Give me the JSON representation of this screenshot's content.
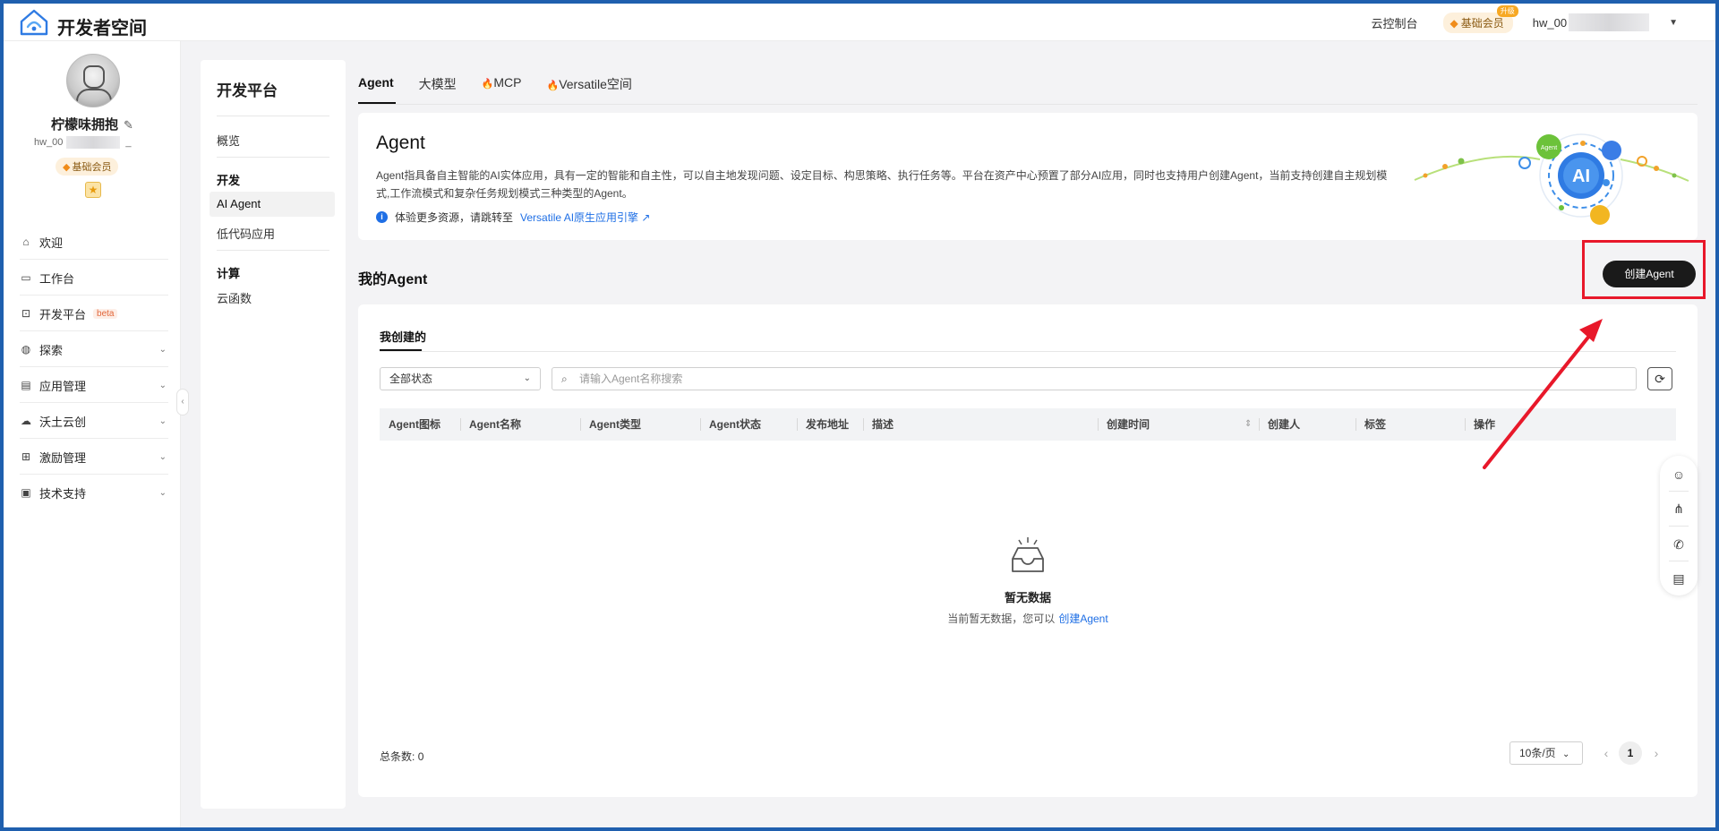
{
  "header": {
    "brand": "开发者空间",
    "console_link": "云控制台",
    "member_label": "基础会员",
    "member_tag": "升级",
    "user_name": "hw_00"
  },
  "profile": {
    "name": "柠檬味拥抱",
    "user_id": "hw_00",
    "user_id_tail": "_",
    "member_label": "基础会员"
  },
  "sidebar": {
    "items": [
      {
        "label": "欢迎",
        "icon": "home-icon"
      },
      {
        "label": "工作台",
        "icon": "workbench-icon"
      },
      {
        "label": "开发平台",
        "icon": "dev-platform-icon",
        "badge": "beta"
      },
      {
        "label": "探索",
        "icon": "explore-icon"
      },
      {
        "label": "应用管理",
        "icon": "app-manage-icon"
      },
      {
        "label": "沃土云创",
        "icon": "cloud-create-icon"
      },
      {
        "label": "激励管理",
        "icon": "gift-icon"
      },
      {
        "label": "技术支持",
        "icon": "support-icon"
      }
    ]
  },
  "subnav": {
    "title": "开发平台",
    "overview": "概览",
    "group_dev": "开发",
    "ai_agent": "AI Agent",
    "lowcode": "低代码应用",
    "group_compute": "计算",
    "cloud_func": "云函数"
  },
  "tabs": [
    {
      "label": "Agent"
    },
    {
      "label": "大模型"
    },
    {
      "label": "MCP"
    },
    {
      "label": "Versatile空间"
    }
  ],
  "intro": {
    "title": "Agent",
    "description": "Agent指具备自主智能的AI实体应用，具有一定的智能和自主性，可以自主地发现问题、设定目标、构思策略、执行任务等。平台在资产中心预置了部分AI应用，同时也支持用户创建Agent，当前支持创建自主规划模式,工作流模式和复杂任务规划模式三种类型的Agent。",
    "note": "体验更多资源，请跳转至",
    "note_link": "Versatile AI原生应用引擎",
    "graphic_label": "AI",
    "graphic_bubble": "Agent"
  },
  "my_agent": {
    "title": "我的Agent",
    "create_button": "创建Agent"
  },
  "list": {
    "tab": "我创建的",
    "status_select": "全部状态",
    "search_placeholder": "请输入Agent名称搜索",
    "columns": [
      "Agent图标",
      "Agent名称",
      "Agent类型",
      "Agent状态",
      "发布地址",
      "描述",
      "创建时间",
      "创建人",
      "标签",
      "操作"
    ],
    "empty_title": "暂无数据",
    "empty_sub": "当前暂无数据，您可以",
    "empty_link": "创建Agent",
    "total_label": "总条数:",
    "total_value": "0",
    "page_size": "10条/页",
    "current_page": "1"
  },
  "colors": {
    "accent": "#1f6fe5",
    "annotation": "#e8182a",
    "primary_button": "#1a1a1a"
  }
}
